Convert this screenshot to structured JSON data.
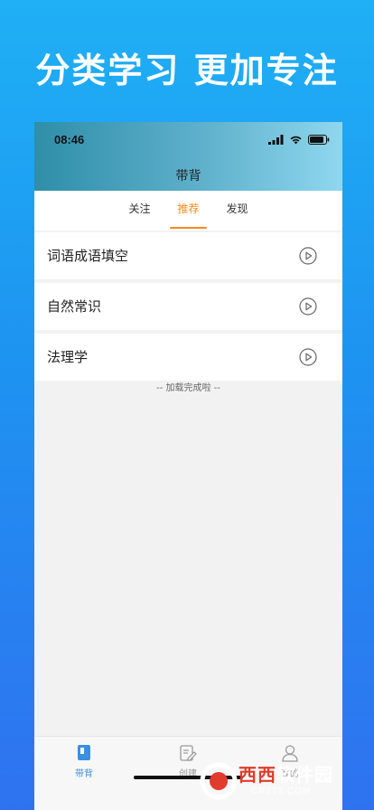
{
  "promo": {
    "headline": "分类学习  更加专注"
  },
  "status_bar": {
    "time": "08:46"
  },
  "header": {
    "title": "带背"
  },
  "tabs": [
    {
      "label": "关注",
      "active": false
    },
    {
      "label": "推荐",
      "active": true
    },
    {
      "label": "发现",
      "active": false
    }
  ],
  "list": {
    "items": [
      {
        "title": "词语成语填空",
        "action_icon": "play-icon"
      },
      {
        "title": "自然常识",
        "action_icon": "play-icon"
      },
      {
        "title": "法理学",
        "action_icon": "play-icon"
      }
    ],
    "footer_text": "-- 加载完成啦 --"
  },
  "bottom_nav": {
    "items": [
      {
        "label": "带背",
        "icon": "book-icon",
        "active": true
      },
      {
        "label": "创建",
        "icon": "edit-icon",
        "active": false
      },
      {
        "label": "我的",
        "icon": "person-icon",
        "active": false
      }
    ]
  },
  "watermark": {
    "brand_red": "西西",
    "brand_white": "软件园",
    "sub": "CR173.COM"
  },
  "colors": {
    "accent": "#f58a1f",
    "nav_active": "#3a8fe0",
    "nav_inactive": "#9a9a9a",
    "background_top": "#1fb0f5",
    "background_bottom": "#2f72f0"
  }
}
